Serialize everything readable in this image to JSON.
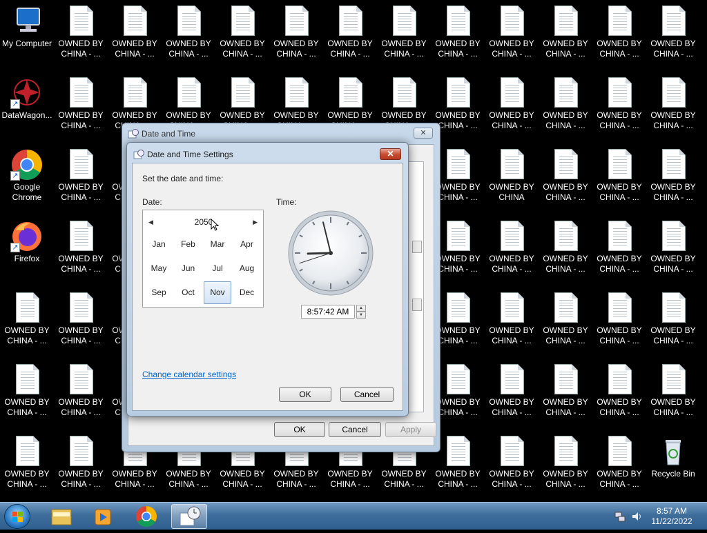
{
  "desktop": {
    "icons": [
      {
        "label": "My Computer",
        "kind": "computer"
      },
      {
        "label": "DataWagon...",
        "kind": "datawagon"
      },
      {
        "label": "Google Chrome",
        "kind": "chrome"
      },
      {
        "label": "Firefox",
        "kind": "firefox"
      },
      {
        "label": "OWNED BY CHINA - ...",
        "kind": "file"
      },
      {
        "label": "OWNED BY CHINA",
        "kind": "file"
      },
      {
        "label": "Recycle Bin",
        "kind": "recycle"
      }
    ],
    "file_label": "OWNED BY CHINA - ...",
    "file_label_alt": "OWNED BY CHINA"
  },
  "back_dialog": {
    "title": "Date and Time",
    "close_label": "✕",
    "ok_label": "OK",
    "cancel_label": "Cancel",
    "apply_label": "Apply"
  },
  "front_dialog": {
    "title": "Date and Time Settings",
    "close_label": "✕",
    "instruction": "Set the date and time:",
    "date_label": "Date:",
    "time_label": "Time:",
    "calendar": {
      "year": "2050",
      "months": [
        "Jan",
        "Feb",
        "Mar",
        "Apr",
        "May",
        "Jun",
        "Jul",
        "Aug",
        "Sep",
        "Oct",
        "Nov",
        "Dec"
      ],
      "selected_month": "Nov"
    },
    "time_value": "8:57:42 AM",
    "change_calendar_link": "Change calendar settings",
    "ok_label": "OK",
    "cancel_label": "Cancel"
  },
  "taskbar": {
    "items": [
      "start-orb",
      "explorer-icon",
      "media-player-icon",
      "chrome-icon",
      "date-time-icon"
    ],
    "active_item": "date-time-icon",
    "clock_time": "8:57 AM",
    "clock_date": "11/22/2022"
  },
  "colors": {
    "desktop_bg": "#000000",
    "link": "#0066cc",
    "close_red": "#c74a2f",
    "taskbar": "#3f6e9c"
  }
}
